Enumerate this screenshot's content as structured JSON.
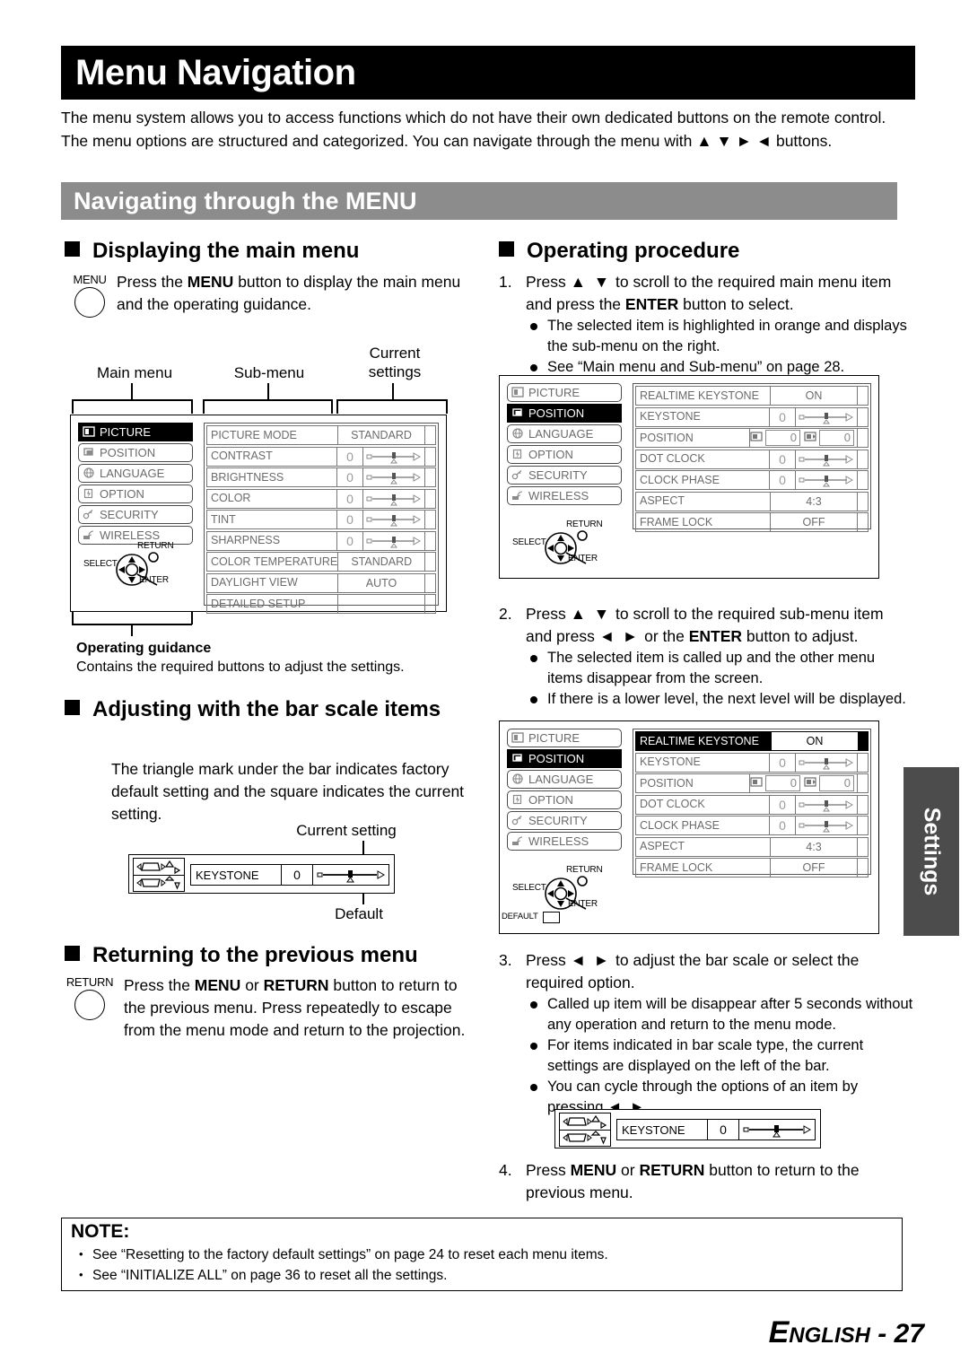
{
  "page": {
    "title": "Menu Navigation",
    "intro": "The menu system allows you to access functions which do not have their own dedicated buttons on the remote control. The menu options are structured and categorized. You can navigate through the menu with ▲ ▼ ► ◄ buttons.",
    "section_bar": "Navigating through the MENU",
    "side_tab": "Settings",
    "footer_language": "ENGLISH",
    "footer_page": "- 27"
  },
  "displaying": {
    "heading": "Displaying the main menu",
    "button_label": "MENU",
    "text": "Press the MENU button to display the main menu and the operating guidance.",
    "labels": {
      "main_menu": "Main menu",
      "sub_menu": "Sub-menu",
      "current_settings": "Current\nsettings"
    },
    "guidance_caption_title": "Operating guidance",
    "guidance_caption_text": "Contains the required buttons to adjust the settings."
  },
  "bar_scale": {
    "heading": "Adjusting with the bar scale items",
    "text": "The triangle mark under the bar indicates factory default setting and the square indicates the current setting.",
    "label_current": "Current setting",
    "label_default": "Default",
    "widget": {
      "name": "KEYSTONE",
      "value": "0"
    }
  },
  "returning": {
    "heading": "Returning to the previous menu",
    "button_label": "RETURN",
    "text": "Press the MENU or RETURN button to return to the previous menu. Press repeatedly to escape from the menu mode and return to the projection."
  },
  "operating": {
    "heading": "Operating procedure",
    "steps": [
      {
        "num": "1.",
        "text": "Press ▲ ▼ to scroll to the required main menu item and press the ENTER button to select.",
        "bullets": [
          "The selected item is highlighted in orange and displays the sub-menu on the right.",
          "See “Main menu and Sub-menu” on page 28."
        ]
      },
      {
        "num": "2.",
        "text": "Press ▲ ▼ to scroll to the required sub-menu item and press ◄ ► or the ENTER button to adjust.",
        "bullets": [
          "The selected item is called up and the other menu items disappear from the screen.",
          "If there is a lower level, the next level will be displayed."
        ]
      },
      {
        "num": "3.",
        "text": "Press ◄ ► to adjust the bar scale or select the required option.",
        "bullets": [
          "Called up item will be disappear after 5 seconds without any operation and return to the menu mode.",
          "For items indicated in bar scale type, the current settings are displayed on the left of the bar.",
          "You can cycle through the options of an item by pressing ◄ ►."
        ]
      },
      {
        "num": "4.",
        "text": "Press MENU or RETURN button to return to the previous menu.",
        "bullets": []
      }
    ],
    "step4_widget": {
      "name": "KEYSTONE",
      "value": "0"
    }
  },
  "osd": {
    "main_menu_items": [
      {
        "label": "PICTURE",
        "icon": "picture-icon"
      },
      {
        "label": "POSITION",
        "icon": "position-icon"
      },
      {
        "label": "LANGUAGE",
        "icon": "globe-icon"
      },
      {
        "label": "OPTION",
        "icon": "option-icon"
      },
      {
        "label": "SECURITY",
        "icon": "key-icon"
      },
      {
        "label": "WIRELESS",
        "icon": "wireless-icon"
      }
    ],
    "guidance": {
      "select": "SELECT",
      "return": "RETURN",
      "enter": "ENTER",
      "default": "DEFAULT"
    },
    "picture_submenu": {
      "selected_main": "PICTURE",
      "rows": [
        {
          "name": "PICTURE MODE",
          "type": "value",
          "value": "STANDARD"
        },
        {
          "name": "CONTRAST",
          "type": "bar",
          "value": "0"
        },
        {
          "name": "BRIGHTNESS",
          "type": "bar",
          "value": "0"
        },
        {
          "name": "COLOR",
          "type": "bar",
          "value": "0"
        },
        {
          "name": "TINT",
          "type": "bar",
          "value": "0"
        },
        {
          "name": "SHARPNESS",
          "type": "bar",
          "value": "0"
        },
        {
          "name": "COLOR TEMPERATURE",
          "type": "value",
          "value": "STANDARD"
        },
        {
          "name": "DAYLIGHT VIEW",
          "type": "value",
          "value": "AUTO"
        },
        {
          "name": "DETAILED SETUP",
          "type": "value",
          "value": ""
        }
      ]
    },
    "position_submenu": {
      "selected_main": "POSITION",
      "rows": [
        {
          "name": "REALTIME KEYSTONE",
          "type": "value",
          "value": "ON"
        },
        {
          "name": "KEYSTONE",
          "type": "bar",
          "value": "0"
        },
        {
          "name": "POSITION",
          "type": "position",
          "value_h": "0",
          "value_v": "0"
        },
        {
          "name": "DOT CLOCK",
          "type": "bar",
          "value": "0"
        },
        {
          "name": "CLOCK PHASE",
          "type": "bar",
          "value": "0"
        },
        {
          "name": "ASPECT",
          "type": "value",
          "value": "4:3"
        },
        {
          "name": "FRAME LOCK",
          "type": "value",
          "value": "OFF"
        }
      ]
    },
    "position_submenu_highlighted": {
      "selected_main": "POSITION",
      "selected_row": "REALTIME KEYSTONE",
      "rows": [
        {
          "name": "REALTIME KEYSTONE",
          "type": "value",
          "value": "ON"
        },
        {
          "name": "KEYSTONE",
          "type": "bar",
          "value": "0"
        },
        {
          "name": "POSITION",
          "type": "position",
          "value_h": "0",
          "value_v": "0"
        },
        {
          "name": "DOT CLOCK",
          "type": "bar",
          "value": "0"
        },
        {
          "name": "CLOCK PHASE",
          "type": "bar",
          "value": "0"
        },
        {
          "name": "ASPECT",
          "type": "value",
          "value": "4:3"
        },
        {
          "name": "FRAME LOCK",
          "type": "value",
          "value": "OFF"
        }
      ]
    }
  },
  "note": {
    "heading": "NOTE:",
    "items": [
      "See “Resetting to the factory default settings” on page 24 to reset each menu items.",
      "See “INITIALIZE ALL” on page 36 to reset all the settings."
    ]
  }
}
